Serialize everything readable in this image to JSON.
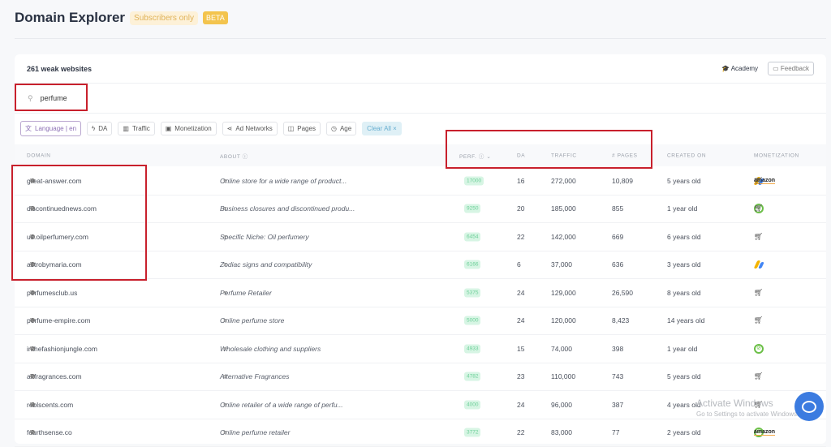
{
  "header": {
    "title": "Domain Explorer",
    "subscribers_badge": "Subscribers only",
    "beta_badge": "BETA"
  },
  "card": {
    "count_label": "261 weak websites",
    "academy": "Academy",
    "feedback": "Feedback"
  },
  "search": {
    "value": "perfume"
  },
  "filters": [
    {
      "label": "Language | en"
    },
    {
      "label": "DA"
    },
    {
      "label": "Traffic"
    },
    {
      "label": "Monetization"
    },
    {
      "label": "Ad Networks"
    },
    {
      "label": "Pages"
    },
    {
      "label": "Age"
    },
    {
      "label": "Clear All ×"
    }
  ],
  "columns": {
    "domain": "DOMAIN",
    "about": "ABOUT ⓘ",
    "perf": "PERF. ⓘ ⌄",
    "da": "DA",
    "traffic": "TRAFFIC",
    "pages": "# PAGES",
    "created": "CREATED ON",
    "monetization": "MONETIZATION"
  },
  "rows": [
    {
      "domain": "great-answer.com",
      "about": "Online store for a wide range of product...",
      "perf": "17000",
      "da": "16",
      "traffic": "272,000",
      "pages": "10,809",
      "created": "5 years old",
      "mon": [
        "adsense",
        "amazon",
        "cart"
      ]
    },
    {
      "domain": "discontinuednews.com",
      "about": "Business closures and discontinued produ...",
      "perf": "9250",
      "da": "20",
      "traffic": "185,000",
      "pages": "855",
      "created": "1 year old",
      "mon": [
        "ezoic",
        "cart"
      ]
    },
    {
      "domain": "us.oilperfumery.com",
      "about": "Specific Niche: Oil perfumery",
      "perf": "6454",
      "da": "22",
      "traffic": "142,000",
      "pages": "669",
      "created": "6 years old",
      "mon": [
        "cart"
      ]
    },
    {
      "domain": "astrobymaria.com",
      "about": "Zodiac signs and compatibility",
      "perf": "6166",
      "da": "6",
      "traffic": "37,000",
      "pages": "636",
      "created": "3 years old",
      "mon": [
        "adsense"
      ]
    },
    {
      "domain": "perfumesclub.us",
      "about": "Perfume Retailer",
      "perf": "5375",
      "da": "24",
      "traffic": "129,000",
      "pages": "26,590",
      "created": "8 years old",
      "mon": [
        "cart"
      ]
    },
    {
      "domain": "perfume-empire.com",
      "about": "Online perfume store",
      "perf": "5000",
      "da": "24",
      "traffic": "120,000",
      "pages": "8,423",
      "created": "14 years old",
      "mon": [
        "cart"
      ]
    },
    {
      "domain": "inthefashionjungle.com",
      "about": "Wholesale clothing and suppliers",
      "perf": "4933",
      "da": "15",
      "traffic": "74,000",
      "pages": "398",
      "created": "1 year old",
      "mon": [
        "ezoic"
      ]
    },
    {
      "domain": "altfragrances.com",
      "about": "Alternative Fragrances",
      "perf": "4782",
      "da": "23",
      "traffic": "110,000",
      "pages": "743",
      "created": "5 years old",
      "mon": [
        "cart"
      ]
    },
    {
      "domain": "reblscents.com",
      "about": "Online retailer of a wide range of perfu...",
      "perf": "4000",
      "da": "24",
      "traffic": "96,000",
      "pages": "387",
      "created": "4 years old",
      "mon": [
        "cart"
      ]
    },
    {
      "domain": "fourthsense.co",
      "about": "Online perfume retailer",
      "perf": "3772",
      "da": "22",
      "traffic": "83,000",
      "pages": "77",
      "created": "2 years old",
      "mon": [
        "ezoic",
        "amazon"
      ]
    }
  ],
  "watermark": {
    "line1": "Activate Windows",
    "line2": "Go to Settings to activate Windows."
  },
  "amazon_label": "amazon"
}
